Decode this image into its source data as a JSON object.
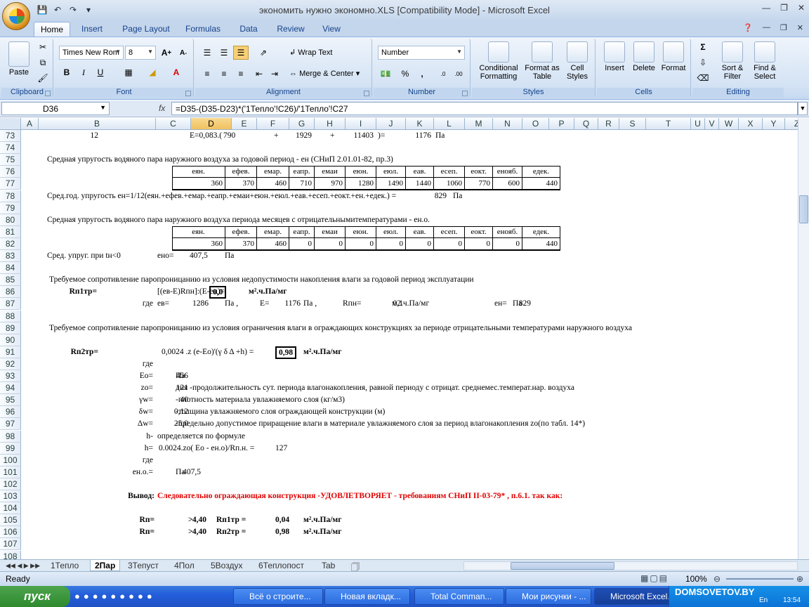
{
  "window": {
    "title": "экономить нужно экономно.XLS  [Compatibility Mode] - Microsoft Excel"
  },
  "ribbon_tabs": [
    "Home",
    "Insert",
    "Page Layout",
    "Formulas",
    "Data",
    "Review",
    "View"
  ],
  "ribbon": {
    "clipboard": {
      "label": "Clipboard",
      "paste": "Paste"
    },
    "font": {
      "label": "Font",
      "name": "Times New Rom",
      "size": "8"
    },
    "alignment": {
      "label": "Alignment",
      "wrap": "Wrap Text",
      "merge": "Merge & Center"
    },
    "number": {
      "label": "Number",
      "format": "Number"
    },
    "styles": {
      "label": "Styles",
      "cond": "Conditional Formatting",
      "table": "Format as Table",
      "cell": "Cell Styles"
    },
    "cells": {
      "label": "Cells",
      "insert": "Insert",
      "delete": "Delete",
      "format": "Format"
    },
    "editing": {
      "label": "Editing",
      "sort": "Sort & Filter",
      "find": "Find & Select"
    }
  },
  "formula_bar": {
    "name_box": "D36",
    "fx": "fx",
    "formula": "=D35-(D35-D23)*('1Тепло'!C26)/'1Тепло'!C27"
  },
  "columns": [
    "A",
    "B",
    "C",
    "D",
    "E",
    "F",
    "G",
    "H",
    "I",
    "J",
    "K",
    "L",
    "M",
    "N",
    "O",
    "P",
    "Q",
    "R",
    "S",
    "T",
    "U",
    "V",
    "W",
    "X",
    "Y",
    "Z"
  ],
  "rows": [
    "73",
    "74",
    "75",
    "76",
    "77",
    "78",
    "79",
    "80",
    "81",
    "82",
    "83",
    "84",
    "85",
    "86",
    "87",
    "88",
    "89",
    "90",
    "91",
    "92",
    "93",
    "94",
    "95",
    "96",
    "97",
    "98",
    "99",
    "100",
    "101",
    "102",
    "103",
    "104",
    "105",
    "106",
    "107",
    "108"
  ],
  "cells": {
    "r73_b": "12",
    "r73_d": "E=0,083.(",
    "r73_e": "790",
    "r73_f": "+",
    "r73_g": "1929",
    "r73_h": "+",
    "r73_i": "11403",
    "r73_j": ")=",
    "r73_k": "1176",
    "r73_l": "Па",
    "r75": "Средная  упругость водяного пара наружного воздуха за годовой период - ен (СНиП 2.01.01-82, пр.3)",
    "r78": "Сред.год. упругость  ен=1/12(еян.+ефев.+емар.+еапр.+емаи+еюн.+еюл.+еав.+есеп.+еокт.+ен.+едек.) =",
    "r78_val": "829",
    "r78_unit": "Па",
    "r80": "Средная  упругость водяного пара наружного воздуха периода месяцев с отрицательнымитемпературами - ен.о.",
    "r83_b": "Сред. упруг. при tн<0",
    "r83_c": "ено=",
    "r83_d": "407,5",
    "r83_e": "Па",
    "r85": "Требуемое сопротивление паропроницанию из условия недопустимости накопления влаги за годовой период эксплуатации",
    "r86_b": "Rп1тр=",
    "r86_c": "[(ев-Е)Rпн]:(Е-ен)=",
    "r86_d": "0,0",
    "r86_e": "м².ч.Па/мг",
    "r87_b": "где",
    "r87_c": "ев=",
    "r87_d": "1286",
    "r87_e": "Па    ,",
    "r87_f": "Е=",
    "r87_g": "1176",
    "r87_h": "Па     ,",
    "r87_i": "Rпн=",
    "r87_j": "0,1",
    "r87_k": "м2.ч.Па/мг",
    "r87_n": "ен=",
    "r87_o": "829",
    "r87_p": "Па",
    "r89": "Требуемое сопротивление паропроницанию из условия ограничения влаги в ограждающих конструкциях за  периоде отрицательными температурами наружного воздуха",
    "r91_b": "Rп2тр=",
    "r91_c": "0,0024 .z (e-Eo)'(γ   δ   Δ   +h) =",
    "r91_g": "0,98",
    "r91_h": "м².ч.Па/мг",
    "r92_b": "где",
    "r93_b": "Eo=",
    "r93_c": "456",
    "r93_d": "Па",
    "r94_b": "zo=",
    "r94_c": "121",
    "r94_d": "дня -продолжительность сут. периода влагонакопления, равной периоду с отрицат. среднемес.температ.нар. воздуха",
    "r95_b": "γw=",
    "r95_c": "40",
    "r95_d": "-плотность материала увлажняемого слоя (кг/м3)",
    "r96_b": "δw=",
    "r96_c": "0,12",
    "r96_d": "-толщина увлажняемого  слоя ограждающей конструкции  (м)",
    "r97_b": "Δw=",
    "r97_c": "25,0",
    "r97_d": "-предельно допустимое приращение влаги в материале увлажняемого слоя за период влагонакопления zo(по табл. 14*)",
    "r98_b": "h-",
    "r98_c": "определяется по формуле",
    "r99_b": "h=",
    "r99_c": "0.0024.zo( Eo - ен.о)/Rп.н. =",
    "r99_g": "127",
    "r100_b": "где",
    "r101_b": "ен.о.=",
    "r101_c": "407,5",
    "r101_d": "Па",
    "r103_b": "Вывод:",
    "r103_c": "Следовательно ограждающая конструкция     -УДОВЛЕТВОРЯЕТ -    требованиям СНиП II-03-79* , п.6.1.  так как:",
    "r105_b": "Rп=",
    "r105_c": "4,40",
    "r105_d": ">",
    "r105_e": "Rп1тр   =",
    "r105_g": "0,04",
    "r105_h": "м².ч.Па/мг",
    "r106_b": "Rп=",
    "r106_c": "4,40",
    "r106_d": ">",
    "r106_e": "Rп2тр   =",
    "r106_g": "0,98",
    "r106_h": "м².ч.Па/мг"
  },
  "table1": {
    "headers": [
      "еян.",
      "ефев.",
      "емар.",
      "еапр.",
      "емаи",
      "еюн.",
      "еюл.",
      "еав.",
      "есеп.",
      "еокт.",
      "енояб.",
      "едек."
    ],
    "values": [
      "360",
      "370",
      "460",
      "710",
      "970",
      "1280",
      "1490",
      "1440",
      "1060",
      "770",
      "600",
      "440"
    ]
  },
  "table2": {
    "headers": [
      "еян.",
      "ефев.",
      "емар.",
      "еапр.",
      "емаи",
      "еюн.",
      "еюл.",
      "еав.",
      "есеп.",
      "еокт.",
      "енояб.",
      "едек."
    ],
    "values": [
      "360",
      "370",
      "460",
      "0",
      "0",
      "0",
      "0",
      "0",
      "0",
      "0",
      "0",
      "440"
    ]
  },
  "sheet_tabs": [
    "1Тепло",
    "2Пар",
    "3Тепуст",
    "4Пол",
    "5Воздух",
    "6Теплопост",
    "Tab"
  ],
  "status": {
    "ready": "Ready",
    "zoom": "100%"
  },
  "taskbar": {
    "start": "пуск",
    "items": [
      "Всё о строите...",
      "Новая вкладк...",
      "Total Comman...",
      "Мои рисунки - ...",
      "Microsoft Excel..."
    ],
    "clock": "13:54",
    "lang": "En"
  },
  "watermark": "DOMSOVETOV.BY"
}
